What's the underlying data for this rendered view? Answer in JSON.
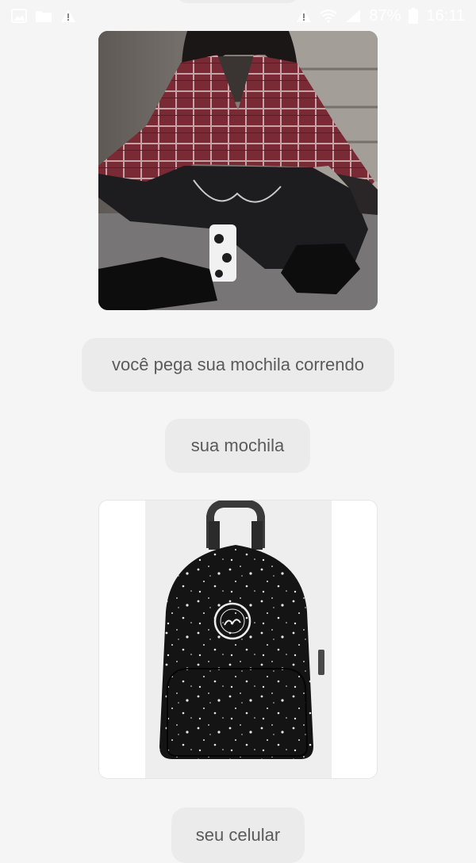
{
  "status_bar": {
    "battery_percent": "87%",
    "time": "16:11"
  },
  "messages": [
    {
      "type": "image",
      "description_icon": "outfit-photo"
    },
    {
      "type": "text",
      "text": "você pega sua mochila correndo"
    },
    {
      "type": "text",
      "text": "sua mochila"
    },
    {
      "type": "image",
      "description_icon": "backpack-photo"
    },
    {
      "type": "text",
      "text": "seu celular"
    }
  ],
  "colors": {
    "background": "#f5f5f5",
    "bubble": "#ebebeb",
    "bubble_text": "#5a5a5a"
  }
}
